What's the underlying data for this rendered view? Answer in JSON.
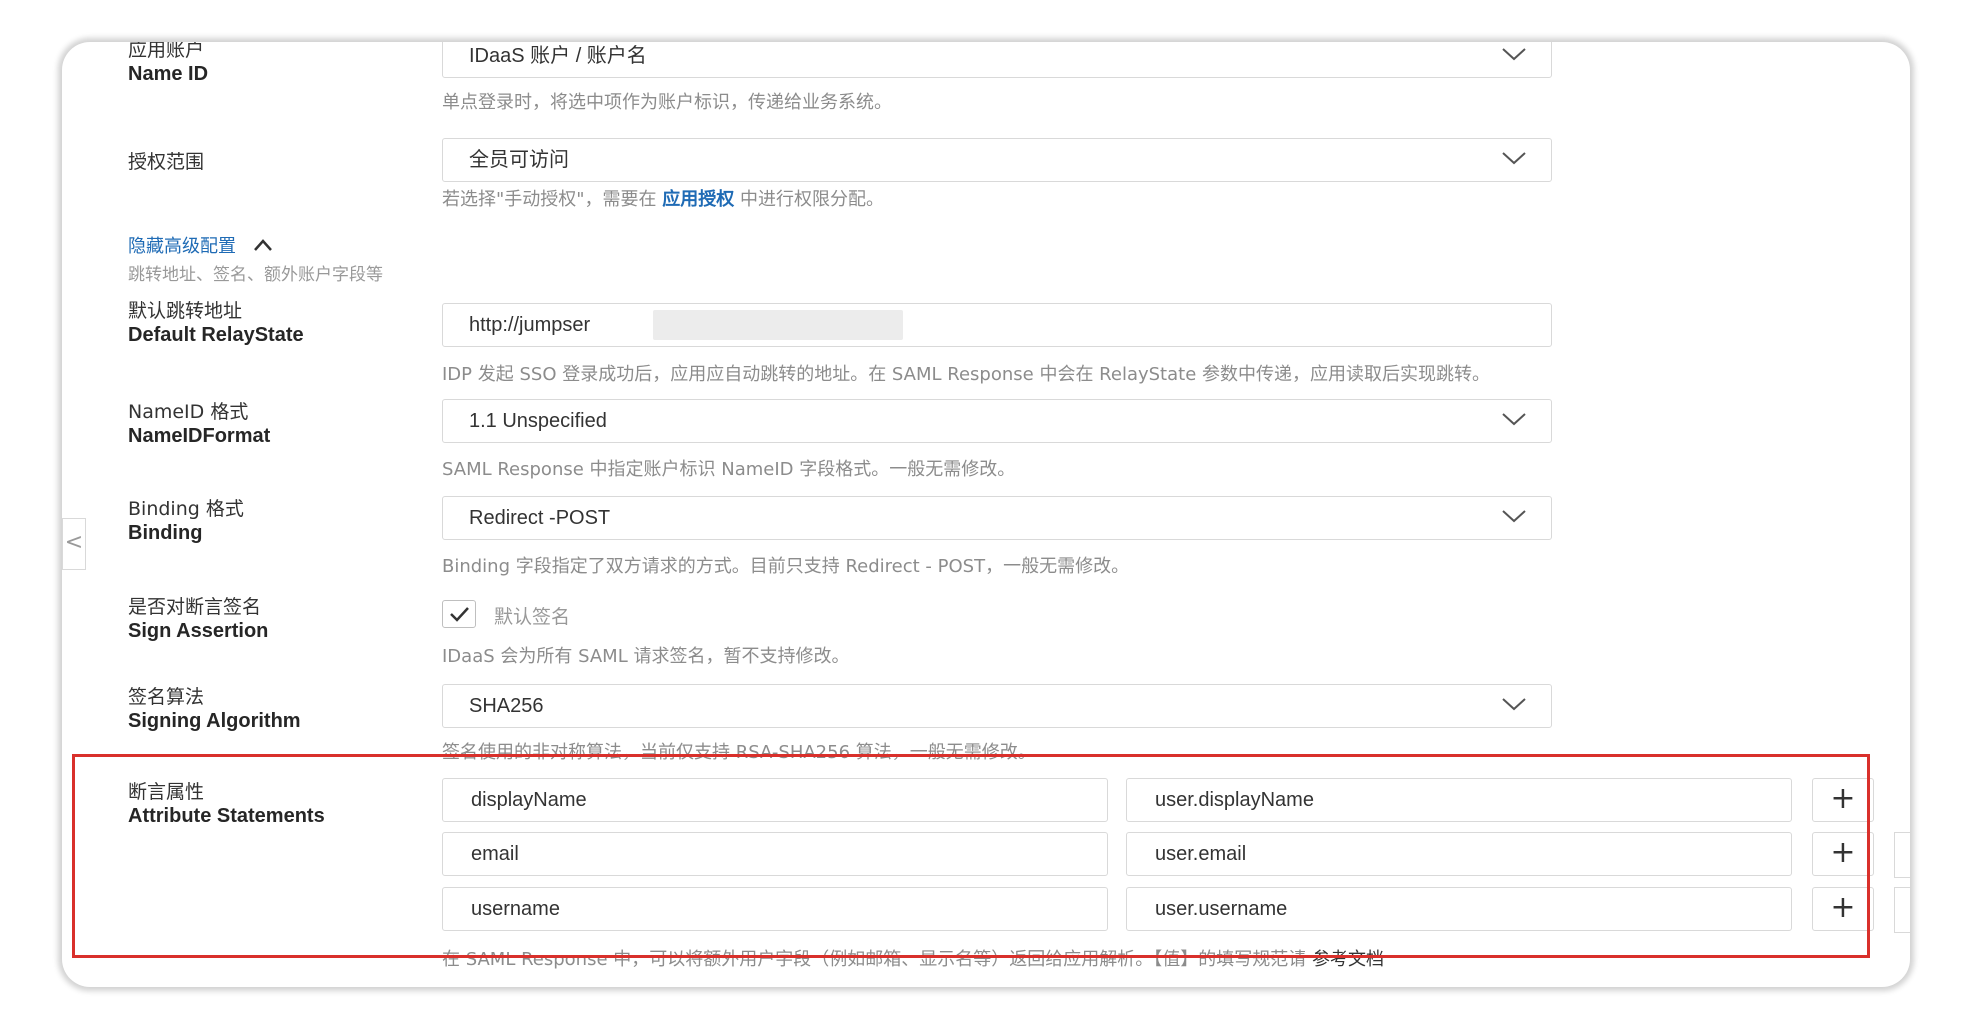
{
  "fields": {
    "name_id": {
      "label_cn": "应用账户",
      "label_en": "Name ID",
      "value": "IDaaS 账户 / 账户名",
      "help": "单点登录时，将选中项作为账户标识，传递给业务系统。"
    },
    "scope": {
      "label_cn": "授权范围",
      "value": "全员可访问",
      "help_prefix": "若选择\"手动授权\"，需要在 ",
      "help_link": "应用授权",
      "help_suffix": " 中进行权限分配。"
    },
    "advanced": {
      "toggle": "隐藏高级配置",
      "sub": "跳转地址、签名、额外账户字段等"
    },
    "relay_state": {
      "label_cn": "默认跳转地址",
      "label_en": "Default RelayState",
      "value": "http://jumpser",
      "help": "IDP 发起 SSO 登录成功后，应用应自动跳转的地址。在 SAML Response 中会在 RelayState 参数中传递，应用读取后实现跳转。"
    },
    "nameid_format": {
      "label_cn": "NameID 格式",
      "label_en": "NameIDFormat",
      "value": "1.1 Unspecified",
      "help": "SAML Response 中指定账户标识 NameID 字段格式。一般无需修改。"
    },
    "binding": {
      "label_cn": "Binding 格式",
      "label_en": "Binding",
      "value": "Redirect -POST",
      "help": "Binding 字段指定了双方请求的方式。目前只支持 Redirect - POST，一般无需修改。"
    },
    "sign_assertion": {
      "label_cn": "是否对断言签名",
      "label_en": "Sign Assertion",
      "checkbox_label": "默认签名",
      "checked": true,
      "help": "IDaaS 会为所有 SAML 请求签名，暂不支持修改。"
    },
    "signing_algorithm": {
      "label_cn": "签名算法",
      "label_en": "Signing Algorithm",
      "value": "SHA256",
      "help": "签名使用的非对称算法，当前仅支持 RSA-SHA256 算法，一般无需修改。"
    },
    "attributes": {
      "label_cn": "断言属性",
      "label_en": "Attribute Statements",
      "rows": [
        {
          "key": "displayName",
          "value": "user.displayName",
          "add": "+"
        },
        {
          "key": "email",
          "value": "user.email",
          "add": "+"
        },
        {
          "key": "username",
          "value": "user.username",
          "add": "+"
        }
      ],
      "help_prefix": "在 SAML Response 中，可以将额外用户字段（例如邮箱、显示名等）返回给应用解析。【值】的填写规范请 ",
      "help_link": "参考文档"
    }
  },
  "colors": {
    "accent": "#1f6bb5",
    "highlight_box": "#d9302b"
  },
  "side_nav": {
    "collapse": "<"
  }
}
